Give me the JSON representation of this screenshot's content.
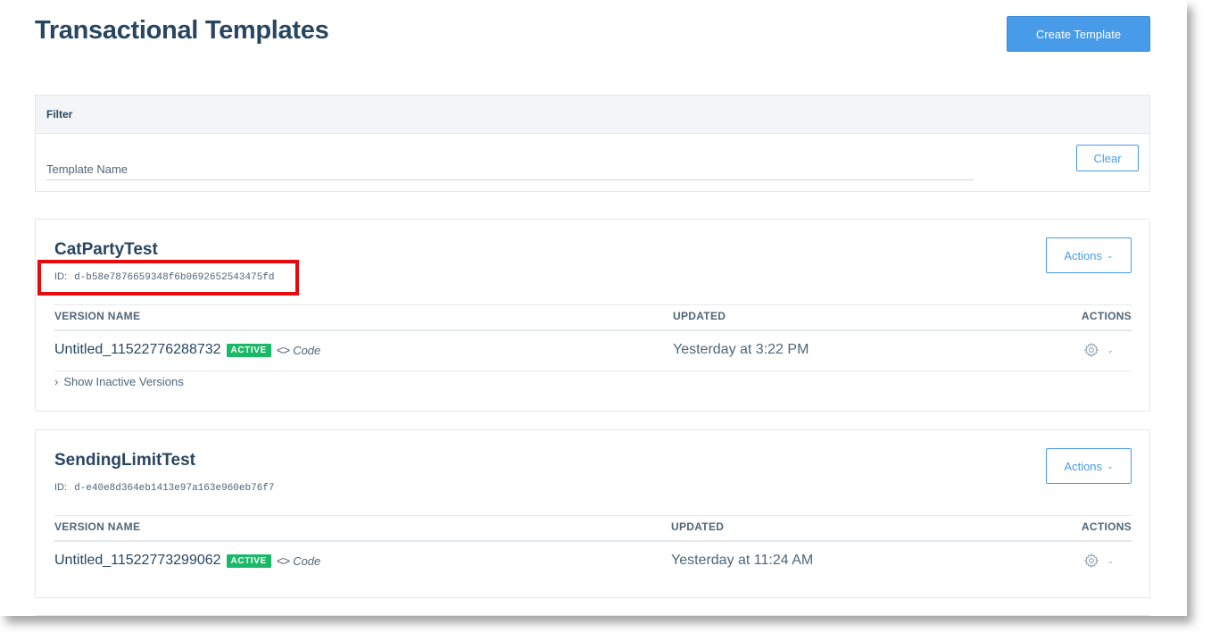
{
  "page": {
    "title": "Transactional Templates",
    "create_button": "Create Template"
  },
  "filter": {
    "heading": "Filter",
    "placeholder": "Template Name",
    "clear_button": "Clear"
  },
  "table_headers": {
    "version_name": "VERSION NAME",
    "updated": "UPDATED",
    "actions": "ACTIONS"
  },
  "templates": [
    {
      "name": "CatPartyTest",
      "id_label": "ID:",
      "id": "d-b58e7876659348f6b0692652543475fd",
      "actions_button": "Actions",
      "version": {
        "name": "Untitled_11522776288732",
        "status": "ACTIVE",
        "code_label": "Code",
        "updated": "Yesterday at 3:22 PM"
      },
      "show_inactive": "Show Inactive Versions",
      "highlighted": true
    },
    {
      "name": "SendingLimitTest",
      "id_label": "ID:",
      "id": "d-e40e8d364eb1413e97a163e960eb76f7",
      "actions_button": "Actions",
      "version": {
        "name": "Untitled_11522773299062",
        "status": "ACTIVE",
        "code_label": "Code",
        "updated": "Yesterday at 11:24 AM"
      }
    }
  ],
  "colors": {
    "primary": "#489be8",
    "active_badge": "#1ab967",
    "highlight": "#e8090c",
    "heading": "#294661"
  },
  "icons": {
    "code": "code-brackets-icon",
    "gear": "gear-icon",
    "chevron": "chevron-down-icon"
  }
}
